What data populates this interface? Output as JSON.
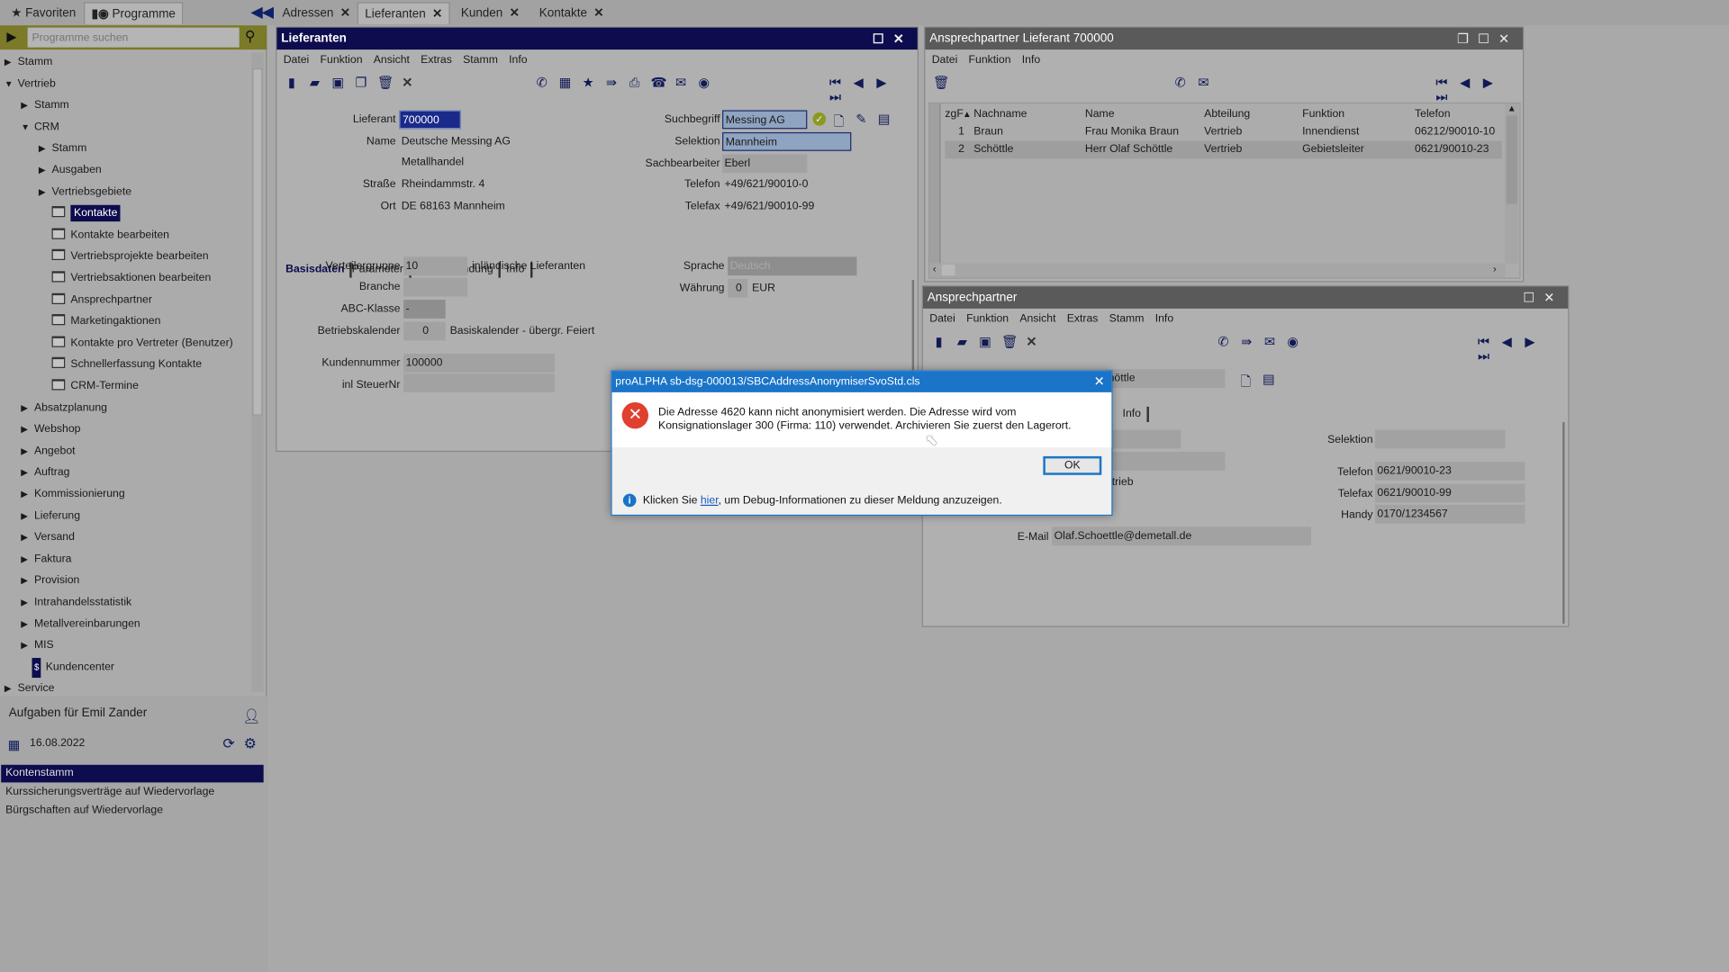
{
  "top_tabs": {
    "favoriten": "Favoriten",
    "programme": "Programme"
  },
  "doc_tabs": [
    "Adressen",
    "Lieferanten",
    "Kunden",
    "Kontakte"
  ],
  "search": {
    "placeholder": "Programme suchen"
  },
  "tree": [
    {
      "label": "Stamm",
      "level": 0,
      "kind": "collapsed"
    },
    {
      "label": "Vertrieb",
      "level": 0,
      "kind": "expanded"
    },
    {
      "label": "Stamm",
      "level": 1,
      "kind": "collapsed"
    },
    {
      "label": "CRM",
      "level": 1,
      "kind": "expanded"
    },
    {
      "label": "Stamm",
      "level": 2,
      "kind": "collapsed"
    },
    {
      "label": "Ausgaben",
      "level": 2,
      "kind": "collapsed"
    },
    {
      "label": "Vertriebsgebiete",
      "level": 2,
      "kind": "collapsed"
    },
    {
      "label": "Kontakte",
      "level": 2,
      "kind": "program",
      "selected": true
    },
    {
      "label": "Kontakte bearbeiten",
      "level": 2,
      "kind": "program"
    },
    {
      "label": "Vertriebsprojekte bearbeiten",
      "level": 2,
      "kind": "program"
    },
    {
      "label": "Vertriebsaktionen bearbeiten",
      "level": 2,
      "kind": "program"
    },
    {
      "label": "Ansprechpartner",
      "level": 2,
      "kind": "program"
    },
    {
      "label": "Marketingaktionen",
      "level": 2,
      "kind": "program"
    },
    {
      "label": "Kontakte pro Vertreter (Benutzer)",
      "level": 2,
      "kind": "program"
    },
    {
      "label": "Schnellerfassung Kontakte",
      "level": 2,
      "kind": "program"
    },
    {
      "label": "CRM-Termine",
      "level": 2,
      "kind": "program"
    },
    {
      "label": "Absatzplanung",
      "level": 1,
      "kind": "collapsed"
    },
    {
      "label": "Webshop",
      "level": 1,
      "kind": "collapsed"
    },
    {
      "label": "Angebot",
      "level": 1,
      "kind": "collapsed"
    },
    {
      "label": "Auftrag",
      "level": 1,
      "kind": "collapsed"
    },
    {
      "label": "Kommissionierung",
      "level": 1,
      "kind": "collapsed"
    },
    {
      "label": "Lieferung",
      "level": 1,
      "kind": "collapsed"
    },
    {
      "label": "Versand",
      "level": 1,
      "kind": "collapsed"
    },
    {
      "label": "Faktura",
      "level": 1,
      "kind": "collapsed"
    },
    {
      "label": "Provision",
      "level": 1,
      "kind": "collapsed"
    },
    {
      "label": "Intrahandelsstatistik",
      "level": 1,
      "kind": "collapsed"
    },
    {
      "label": "Metallvereinbarungen",
      "level": 1,
      "kind": "collapsed"
    },
    {
      "label": "MIS",
      "level": 1,
      "kind": "collapsed"
    },
    {
      "label": "Kundencenter",
      "level": 1,
      "kind": "dashboard"
    },
    {
      "label": "Service",
      "level": 0,
      "kind": "collapsed"
    }
  ],
  "tasks": {
    "title": "Aufgaben für Emil Zander",
    "date": "16.08.2022",
    "items": [
      "Kontenstamm",
      "Kurssicherungsverträge auf Wiedervorlage",
      "Bürgschaften auf Wiedervorlage"
    ]
  },
  "lieferanten": {
    "title": "Lieferanten",
    "menu": [
      "Datei",
      "Funktion",
      "Ansicht",
      "Extras",
      "Stamm",
      "Info"
    ],
    "labels": {
      "lieferant": "Lieferant",
      "name": "Name",
      "strasse": "Straße",
      "ort": "Ort",
      "suchbegriff": "Suchbegriff",
      "selektion": "Selektion",
      "sachbearbeiter": "Sachbearbeiter",
      "telefon": "Telefon",
      "telefax": "Telefax"
    },
    "values": {
      "lieferant": "700000",
      "name": "Deutsche Messing AG",
      "name2": "Metallhandel",
      "strasse": "Rheindammstr. 4",
      "ort": "DE 68163 Mannheim",
      "suchbegriff": "Messing AG",
      "selektion": "Mannheim",
      "sachbearbeiter": "Eberl",
      "telefon": "+49/621/90010-0",
      "telefax": "+49/621/90010-99"
    },
    "tabs": [
      "Basisdaten",
      "Parameter",
      "Bankverbindung",
      "Info"
    ],
    "basis": {
      "verteilergruppe_label": "Verteilergruppe",
      "verteilergruppe": "10",
      "verteilergruppe_text": "inländische Lieferanten",
      "branche_label": "Branche",
      "abc_label": "ABC-Klasse",
      "abc": "-",
      "betriebskalender_label": "Betriebskalender",
      "betriebskalender": "0",
      "betriebskalender_text": "Basiskalender - übergr. Feiert",
      "kundennummer_label": "Kundennummer",
      "kundennummer": "100000",
      "steuernr_label": "inl SteuerNr",
      "sprache_label": "Sprache",
      "sprache": "Deutsch",
      "waehrung_label": "Währung",
      "waehrung": "0",
      "waehrung_text": "EUR"
    }
  },
  "ap_lieferant": {
    "title": "Ansprechpartner Lieferant 700000",
    "menu": [
      "Datei",
      "Funktion",
      "Info"
    ],
    "columns": [
      "zgF",
      "Nachname",
      "Name",
      "Abteilung",
      "Funktion",
      "Telefon"
    ],
    "rows": [
      [
        "1",
        "Braun",
        "Frau Monika Braun",
        "Vertrieb",
        "Innendienst",
        "06212/90010-10"
      ],
      [
        "2",
        "Schöttle",
        "Herr Olaf Schöttle",
        "Vertrieb",
        "Gebietsleiter",
        "0621/90010-23"
      ]
    ]
  },
  "ansprechpartner": {
    "title": "Ansprechpartner",
    "menu": [
      "Datei",
      "Funktion",
      "Ansicht",
      "Extras",
      "Stamm",
      "Info"
    ],
    "name_partial": "höttle",
    "tab_info": "Info",
    "abteilung_partial": "rtrieb",
    "selektion_label": "Selektion",
    "telefon_label": "Telefon",
    "telefon": "0621/90010-23",
    "telefax_label": "Telefax",
    "telefax": "0621/90010-99",
    "handy_label": "Handy",
    "handy": "0170/1234567",
    "email_label": "E-Mail",
    "email": "Olaf.Schoettle@demetall.de"
  },
  "dialog": {
    "title": "proALPHA sb-dsg-000013/SBCAddressAnonymiserSvoStd.cls",
    "message": "Die Adresse 4620 kann nicht anonymisiert werden. Die Adresse wird vom Konsignationslager 300 (Firma: 110) verwendet. Archivieren Sie zuerst den Lagerort.",
    "ok": "OK",
    "debug_pre": "Klicken Sie ",
    "debug_link": "hier",
    "debug_post": ", um Debug-Informationen zu dieser Meldung anzuzeigen."
  },
  "colors": {
    "active_title": "#0c0c4e",
    "inactive_title": "#5a5a5a",
    "dialog_title": "#1a74c8",
    "selection": "#0c0c4e",
    "search_bar": "#7a7a28"
  }
}
